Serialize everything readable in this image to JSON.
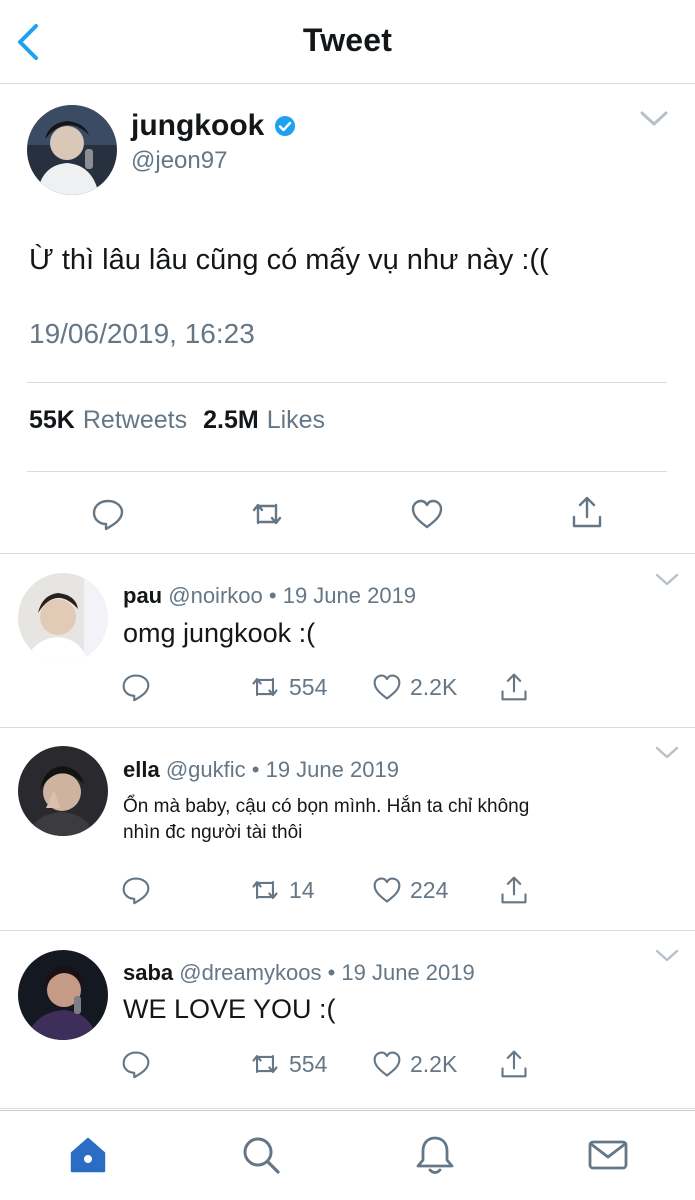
{
  "header": {
    "title": "Tweet",
    "back_icon": "chevron-left-icon"
  },
  "tweet": {
    "author": {
      "name": "jungkook",
      "handle": "@jeon97",
      "verified": true
    },
    "text": "Ừ thì lâu lâu cũng có mấy vụ như này :((",
    "timestamp": "19/06/2019, 16:23",
    "stats": {
      "retweets_count": "55K",
      "retweets_label": "Retweets",
      "likes_count": "2.5M",
      "likes_label": "Likes"
    },
    "actions": [
      "reply-icon",
      "retweet-icon",
      "like-icon",
      "share-icon"
    ]
  },
  "replies": [
    {
      "name": "pau",
      "handle": "@noirkoo",
      "sep": "•",
      "date": "19 June 2019",
      "text": "omg jungkook :(",
      "retweets": "554",
      "likes": "2.2K"
    },
    {
      "name": "ella",
      "handle": "@gukfic",
      "sep": "•",
      "date": "19 June 2019",
      "text": "Ổn mà baby, cậu có bọn mình. Hắn ta chỉ không nhìn đc người tài thôi",
      "retweets": "14",
      "likes": "224"
    },
    {
      "name": "saba",
      "handle": "@dreamykoos",
      "sep": "•",
      "date": "19 June 2019",
      "text": "WE LOVE YOU :(",
      "retweets": "554",
      "likes": "2.2K"
    }
  ],
  "tabbar": {
    "items": [
      "home-icon",
      "search-icon",
      "notifications-icon",
      "messages-icon"
    ],
    "active": "home-icon"
  },
  "colors": {
    "accent": "#1da1f2",
    "text": "#14171a",
    "muted": "#657786",
    "border": "#d9dde0",
    "tab_active": "#2b6cc4"
  }
}
